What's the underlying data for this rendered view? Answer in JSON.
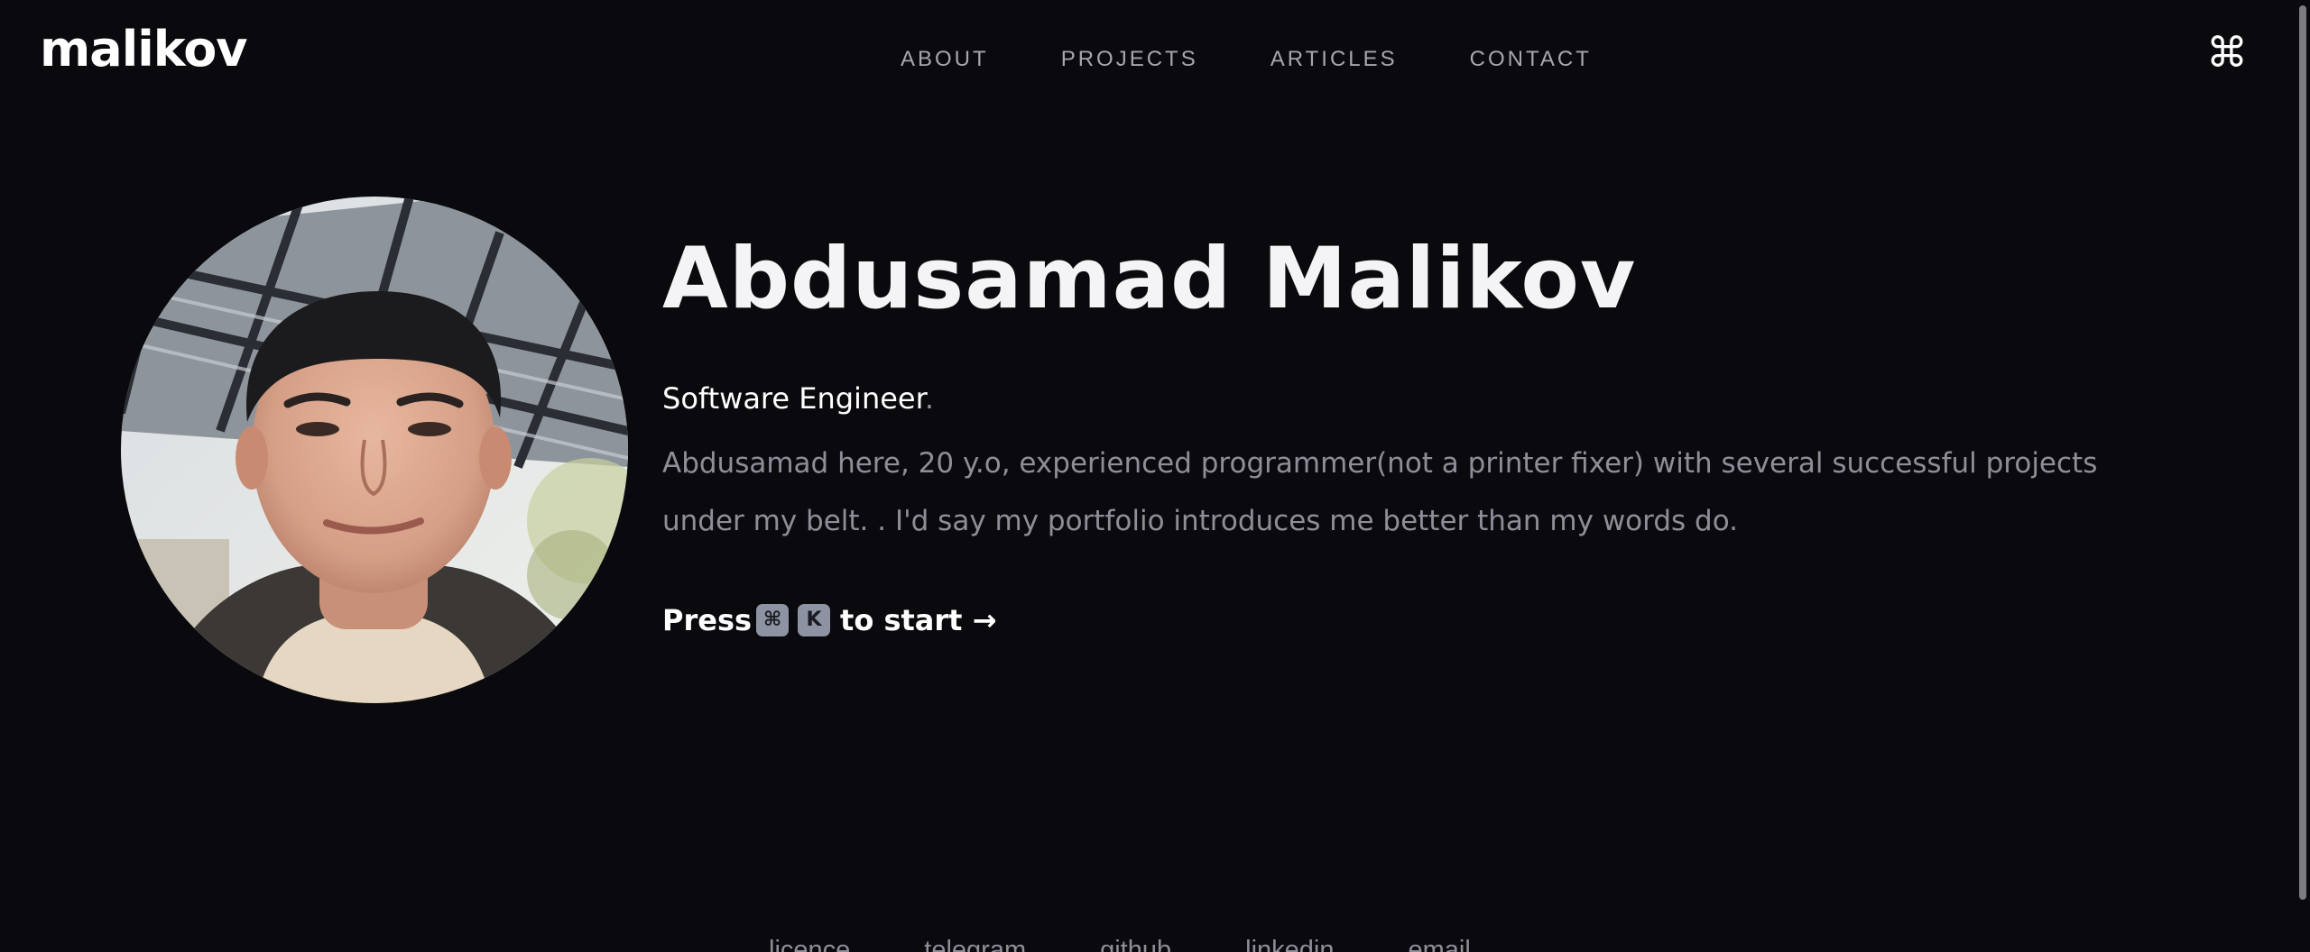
{
  "header": {
    "logo": "malikov",
    "nav": [
      "ABOUT",
      "PROJECTS",
      "ARTICLES",
      "CONTACT"
    ],
    "command_icon": "⌘"
  },
  "hero": {
    "name": "Abdusamad Malikov",
    "role": "Software Engineer",
    "role_suffix": ".",
    "bio": "Abdusamad here, 20 y.o, experienced programmer(not a printer fixer) with several successful projects under my belt. . I'd say my portfolio introduces me better than my words do.",
    "cta_press": "Press",
    "cta_key_cmd": "⌘",
    "cta_key_k": "K",
    "cta_text": "to start →"
  },
  "footer": {
    "links": [
      "licence",
      "telegram",
      "github",
      "linkedin",
      "email"
    ]
  },
  "colors": {
    "background": "#0a0a0e",
    "text_primary": "#ffffff",
    "text_muted": "#8e8e98",
    "kbd_bg": "#8d93a2"
  }
}
